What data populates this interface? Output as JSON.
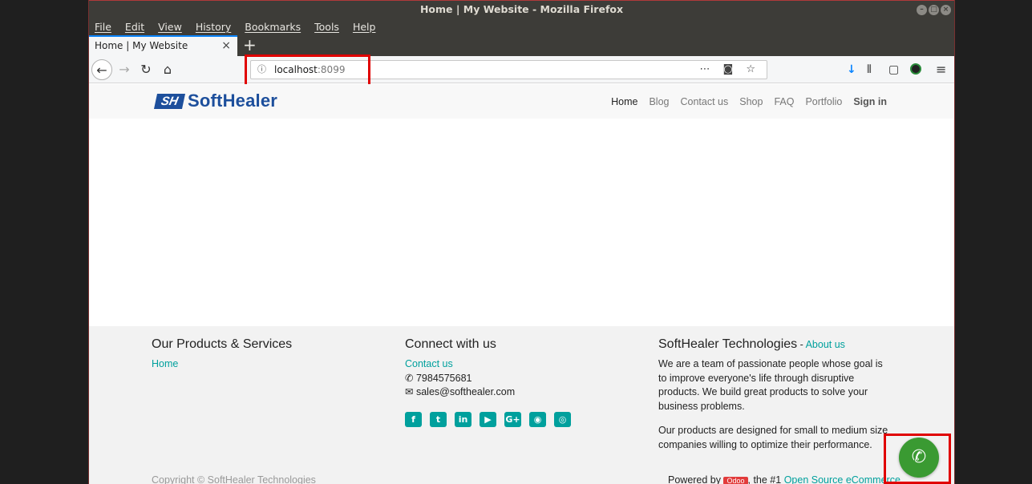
{
  "window": {
    "title": "Home | My Website - Mozilla Firefox"
  },
  "menubar": {
    "items": [
      "File",
      "Edit",
      "View",
      "History",
      "Bookmarks",
      "Tools",
      "Help"
    ]
  },
  "tab": {
    "title": "Home | My Website",
    "close": "×",
    "new_tab": "+"
  },
  "nav": {
    "back": "←",
    "forward": "→",
    "reload": "↻",
    "home": "⌂",
    "url_host": "localhost",
    "url_port": ":8099",
    "url_info": "ⓘ",
    "url_actions": "⋯ ◙ ☆",
    "download": "↓",
    "library": "⫴",
    "sidebar": "▢",
    "menu": "≡"
  },
  "site": {
    "logo_mark": "SH",
    "logo_text": "SoftHealer",
    "nav": [
      "Home",
      "Blog",
      "Contact us",
      "Shop",
      "FAQ",
      "Portfolio"
    ],
    "signin": "Sign in"
  },
  "footer": {
    "col1": {
      "heading": "Our Products & Services",
      "links": [
        "Home"
      ]
    },
    "col2": {
      "heading": "Connect with us",
      "contact_link": "Contact us",
      "phone": "7984575681",
      "email": "sales@softhealer.com",
      "phone_icon": "✆",
      "email_icon": "✉",
      "social": [
        {
          "name": "facebook-icon",
          "glyph": "f"
        },
        {
          "name": "twitter-icon",
          "glyph": "t"
        },
        {
          "name": "linkedin-icon",
          "glyph": "in"
        },
        {
          "name": "youtube-icon",
          "glyph": "▶"
        },
        {
          "name": "google-plus-icon",
          "glyph": "G+"
        },
        {
          "name": "github-icon",
          "glyph": "◉"
        },
        {
          "name": "instagram-icon",
          "glyph": "◎"
        }
      ]
    },
    "col3": {
      "heading": "SoftHealer Technologies",
      "separator": " - ",
      "about_link": "About us",
      "para1": "We are a team of passionate people whose goal is to improve everyone's life through disruptive products. We build great products to solve your business problems.",
      "para2": "Our products are designed for small to medium size companies willing to optimize their performance."
    },
    "copyright": "Copyright © SoftHealer Technologies",
    "powered_prefix": "Powered by ",
    "powered_badge": "Odoo",
    "powered_mid": ", the #1 ",
    "powered_link": "Open Source eCommerce"
  },
  "whatsapp": {
    "glyph": "✆"
  },
  "colors": {
    "accent": "#00a09d",
    "brand": "#1d4f9c",
    "highlight": "#e00000"
  }
}
